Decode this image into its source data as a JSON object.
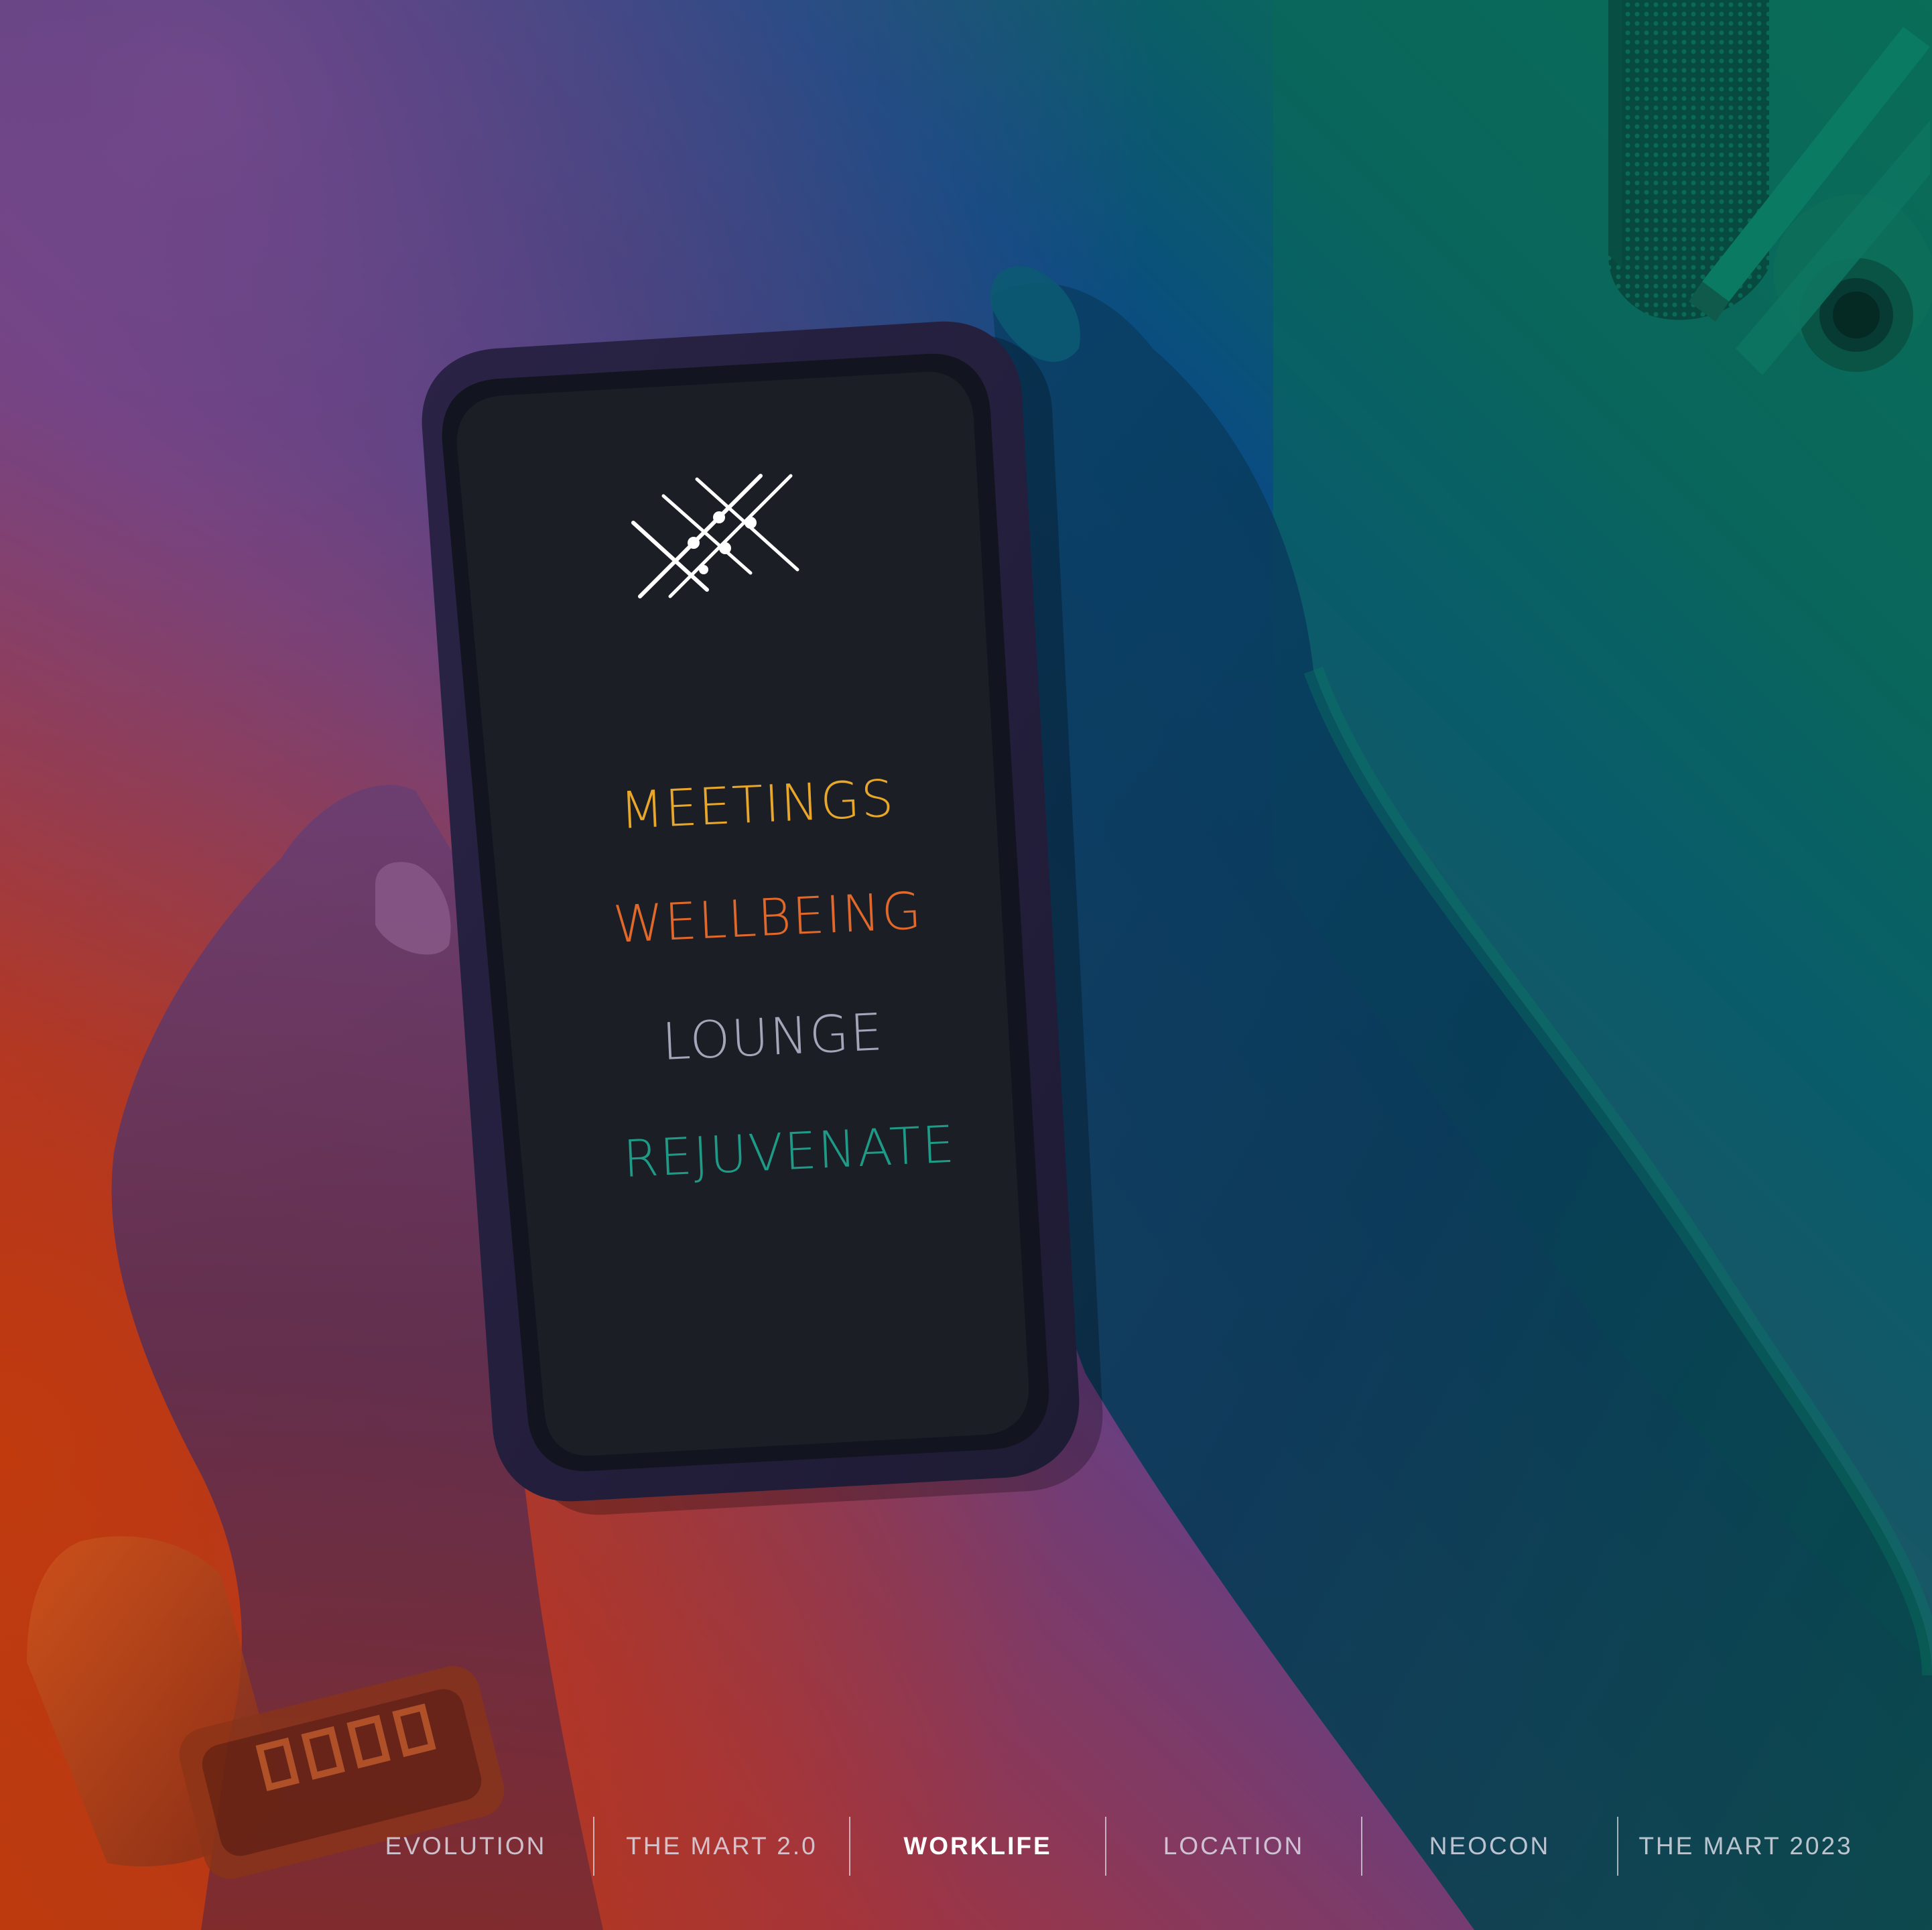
{
  "phone_screen": {
    "logo": "crosshatch-star-logo",
    "menu": [
      {
        "label": "MEETINGS",
        "color": "#e8a62a"
      },
      {
        "label": "WELLBEING",
        "color": "#e0682a"
      },
      {
        "label": "LOUNGE",
        "color": "#a3a6b8"
      },
      {
        "label": "REJUVENATE",
        "color": "#1e9a86"
      }
    ]
  },
  "nav": {
    "items": [
      {
        "label": "EVOLUTION",
        "active": false
      },
      {
        "label": "THE MART 2.0",
        "active": false
      },
      {
        "label": "WORKLIFE",
        "active": true
      },
      {
        "label": "LOCATION",
        "active": false
      },
      {
        "label": "NEOCON",
        "active": false
      },
      {
        "label": "THE MART 2023",
        "active": false
      }
    ]
  },
  "colors": {
    "gradient_left": "#b3321c",
    "gradient_mid": "#6a3f86",
    "gradient_blue": "#0b4a8a",
    "gradient_right": "#0a6a5a",
    "screen": "#1b1e24"
  }
}
